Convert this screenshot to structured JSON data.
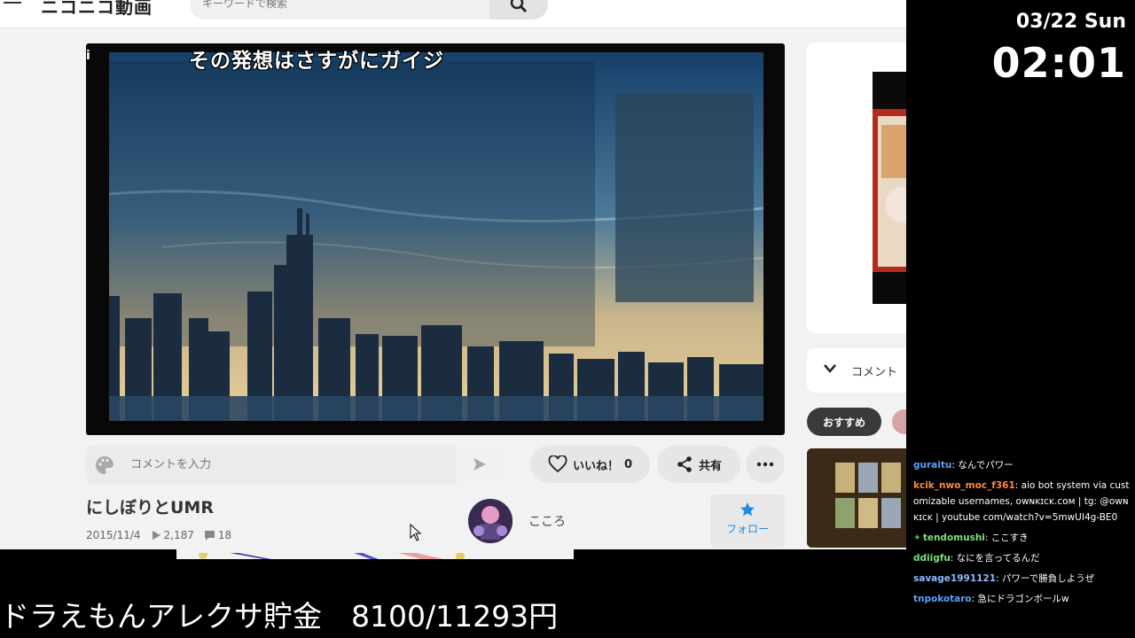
{
  "header": {
    "logo": "ニコニコ動画",
    "search_placeholder": "キーワードで検索"
  },
  "player": {
    "danmaku_comment": "その発想はさすがにガイジ",
    "corner_mark": "i"
  },
  "comment_box": {
    "placeholder": "コメントを入力"
  },
  "actions": {
    "like_label": "いいね！",
    "like_count": "0",
    "share_label": "共有"
  },
  "video": {
    "title": "にしぼりとUMR",
    "date": "2015/11/4",
    "views": "2,187",
    "comments": "18"
  },
  "uploader": {
    "name": "こころ",
    "follow_label": "フォロー"
  },
  "sidebar": {
    "comment_toggle_label": "コメント",
    "recommend_tab": "おすすめ"
  },
  "overlay": {
    "date": "03/22 Sun",
    "time": "02:01",
    "donation_text": "ドラえもんアレクサ貯金　8100/11293円",
    "chat": [
      {
        "user": "guraitu",
        "color": "#5aa0ff",
        "message": ": なんでパワー",
        "badge": ""
      },
      {
        "user": "kcik_nwo_moc_f361",
        "color": "#ff8a3d",
        "message": ": aio bot system via customizable usernames, ᴏᴡɴᴋɪᴄᴋ.ᴄᴏᴍ | tg: @ᴏᴡɴᴋɪᴄᴋ | youtube com/watch?v=5mwUI4g-BE0",
        "badge": ""
      },
      {
        "user": "tendomushi",
        "color": "#7ee07e",
        "message": ": ここすき",
        "badge": "✦"
      },
      {
        "user": "ddiigfu",
        "color": "#7ee07e",
        "message": ": なにを言ってるんだ",
        "badge": ""
      },
      {
        "user": "savage1991121",
        "color": "#8fb8ff",
        "message": ": パワーで勝負しようぜ",
        "badge": ""
      },
      {
        "user": "tnpokotaro",
        "color": "#5aa0ff",
        "message": ": 急にドラゴンボールw",
        "badge": ""
      }
    ]
  },
  "colors": {
    "accent_blue": "#1e88e5",
    "overlay_bg": "#000000"
  }
}
